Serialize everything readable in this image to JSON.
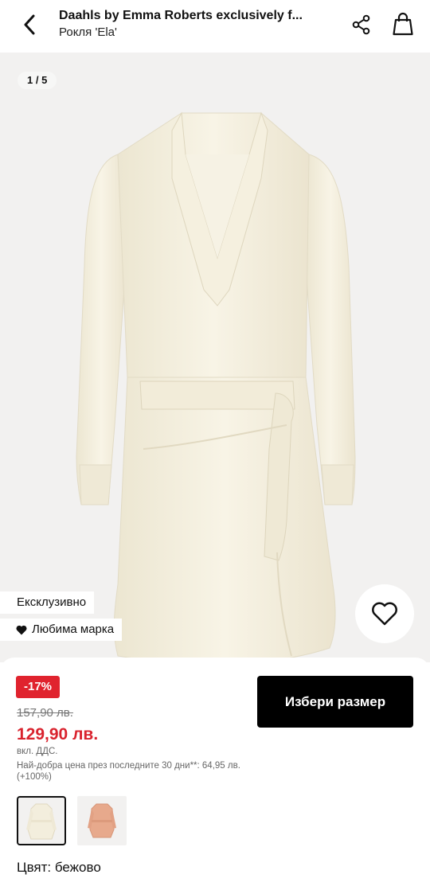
{
  "header": {
    "title": "Daahls by Emma Roberts exclusively f...",
    "subtitle": "Рокля 'Ela'",
    "back_icon": "chevron-left-icon",
    "share_icon": "share-icon",
    "bag_icon": "shopping-bag-icon"
  },
  "gallery": {
    "counter": "1 / 5",
    "badges": {
      "exclusive": "Ексклузивно",
      "favorite_brand": "Любима марка"
    },
    "wishlist_icon": "heart-outline-icon",
    "background": "#f2f1f0",
    "dress_color": "#f3eedd"
  },
  "pricing": {
    "discount": "-17%",
    "old_price": "157,90 лв.",
    "new_price": "129,90 лв.",
    "vat_note": "вкл. ДДС.",
    "best_price_note": "Най-добра цена през последните 30 дни**: 64,95 лв. (+100%)",
    "sale_color": "#e0232e"
  },
  "actions": {
    "select_size": "Избери размер"
  },
  "variants": {
    "options": [
      {
        "name": "beige",
        "color": "#f3eedd",
        "selected": true
      },
      {
        "name": "peach",
        "color": "#e7a98c",
        "selected": false
      }
    ],
    "color_label": "Цвят: бежово"
  }
}
